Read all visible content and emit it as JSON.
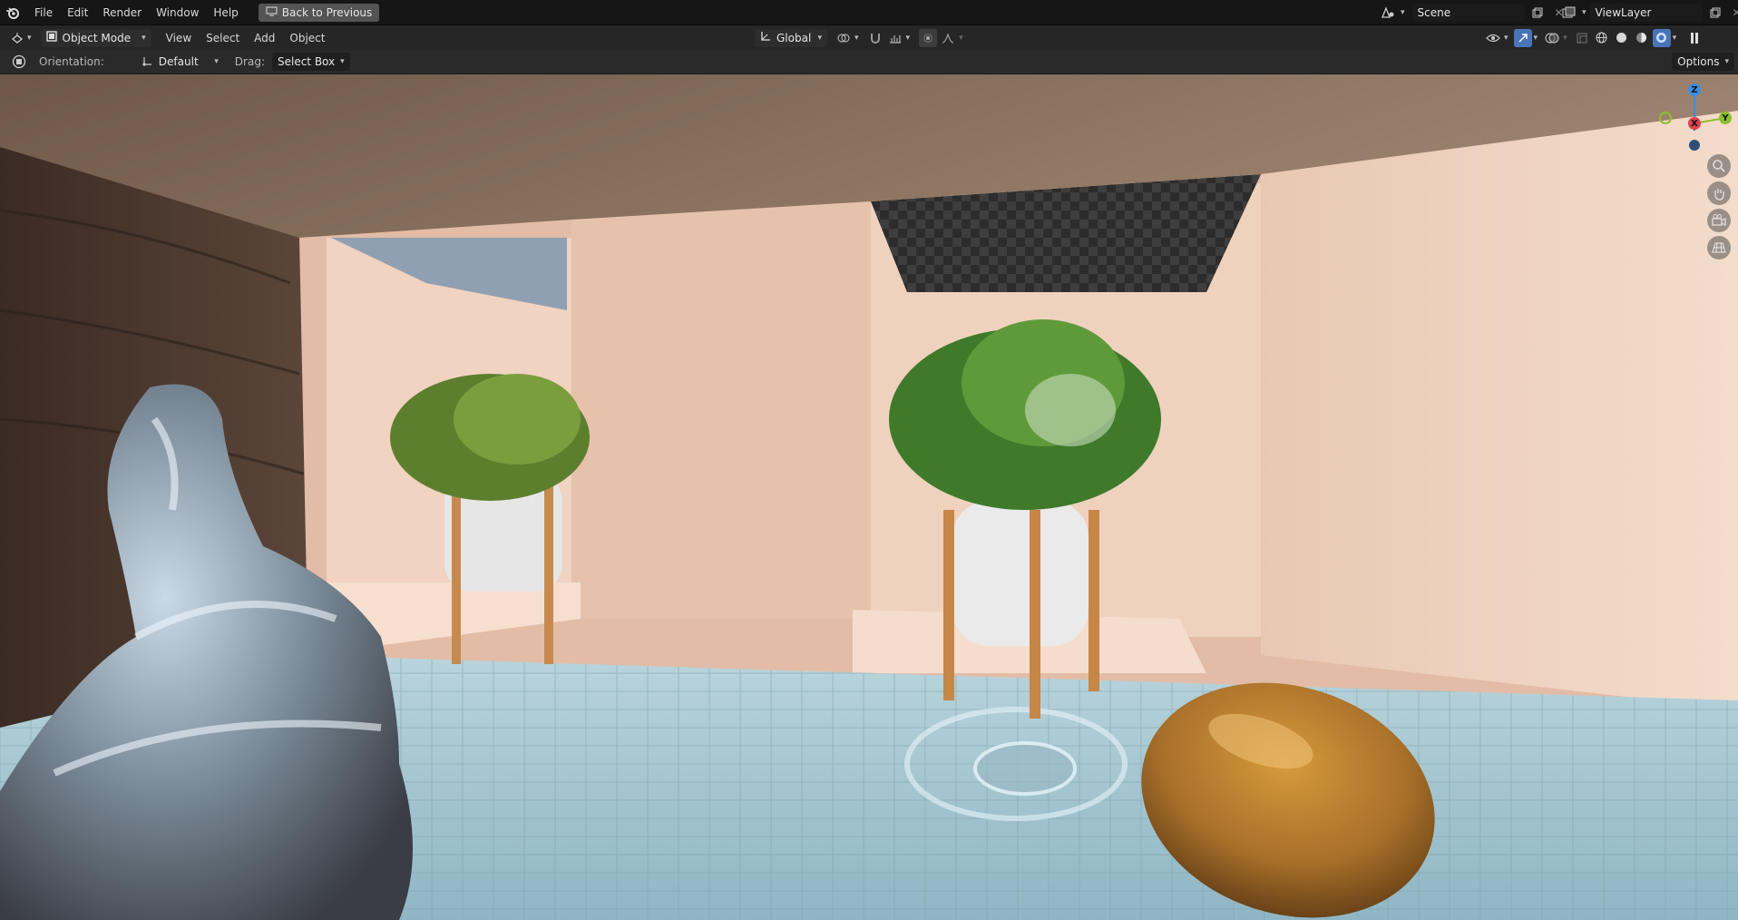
{
  "topbar": {
    "menu": [
      "File",
      "Edit",
      "Render",
      "Window",
      "Help"
    ],
    "back_button": "Back to Previous",
    "scene": "Scene",
    "view_layer": "ViewLayer"
  },
  "header": {
    "mode": "Object Mode",
    "menu": [
      "View",
      "Select",
      "Add",
      "Object"
    ],
    "transform_orientation": "Global"
  },
  "toolsettings": {
    "orientation_label": "Orientation:",
    "orientation_value": "Default",
    "drag_label": "Drag:",
    "drag_value": "Select Box",
    "options": "Options"
  },
  "gizmo": {
    "z": "Z",
    "x": "X",
    "y": "Y"
  },
  "colors": {
    "axis_x": "#e0414e",
    "axis_y": "#8dbe2d",
    "axis_z": "#3b8ee6"
  }
}
